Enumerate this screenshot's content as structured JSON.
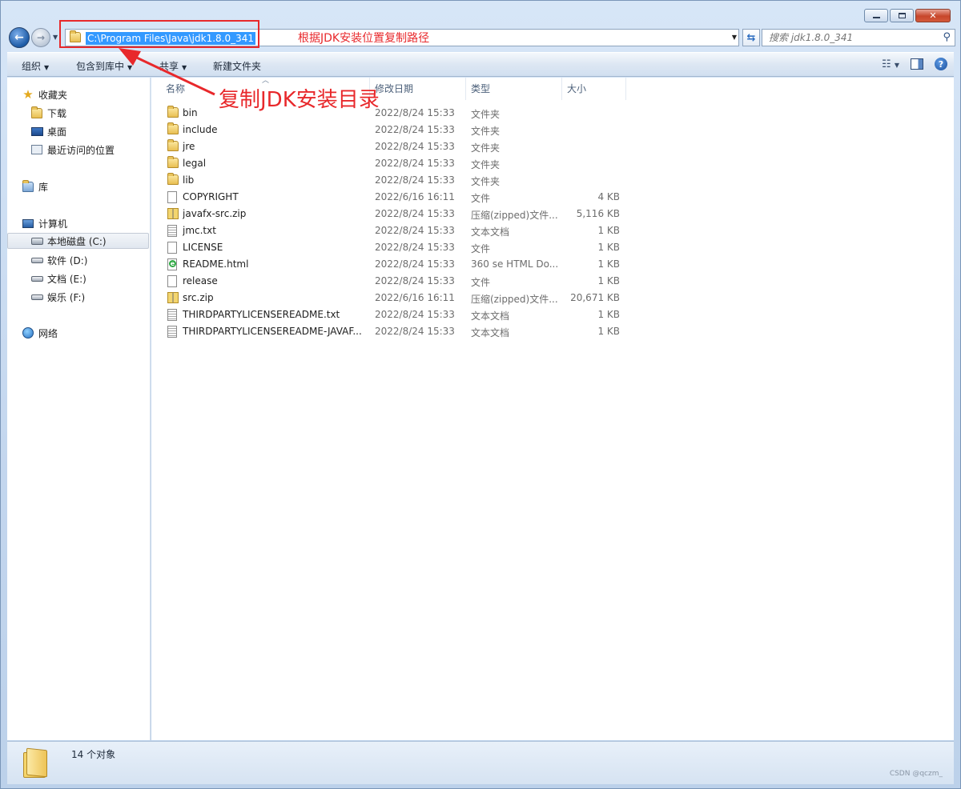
{
  "window": {
    "caption": {
      "minimize": "–",
      "maximize": "□",
      "close": "✕"
    }
  },
  "nav": {
    "address_path": "C:\\Program Files\\Java\\jdk1.8.0_341",
    "search_placeholder": "搜索 jdk1.8.0_341"
  },
  "toolbar": {
    "organize": "组织",
    "include_in_library": "包含到库中",
    "share": "共享",
    "new_folder": "新建文件夹"
  },
  "sidebar": {
    "favorites": "收藏夹",
    "downloads": "下载",
    "desktop": "桌面",
    "recent": "最近访问的位置",
    "libraries": "库",
    "computer": "计算机",
    "drive_c": "本地磁盘 (C:)",
    "drive_d": "软件 (D:)",
    "drive_e": "文档 (E:)",
    "drive_f": "娱乐 (F:)",
    "network": "网络"
  },
  "columns": {
    "name": "名称",
    "modified": "修改日期",
    "type": "类型",
    "size": "大小"
  },
  "files": [
    {
      "name": "bin",
      "modified": "2022/8/24 15:33",
      "type": "文件夹",
      "size": "",
      "icon": "folder-icon"
    },
    {
      "name": "include",
      "modified": "2022/8/24 15:33",
      "type": "文件夹",
      "size": "",
      "icon": "folder-icon"
    },
    {
      "name": "jre",
      "modified": "2022/8/24 15:33",
      "type": "文件夹",
      "size": "",
      "icon": "folder-icon"
    },
    {
      "name": "legal",
      "modified": "2022/8/24 15:33",
      "type": "文件夹",
      "size": "",
      "icon": "folder-icon"
    },
    {
      "name": "lib",
      "modified": "2022/8/24 15:33",
      "type": "文件夹",
      "size": "",
      "icon": "folder-icon"
    },
    {
      "name": "COPYRIGHT",
      "modified": "2022/6/16 16:11",
      "type": "文件",
      "size": "4 KB",
      "icon": "file-icon"
    },
    {
      "name": "javafx-src.zip",
      "modified": "2022/8/24 15:33",
      "type": "压缩(zipped)文件...",
      "size": "5,116 KB",
      "icon": "zip-icon"
    },
    {
      "name": "jmc.txt",
      "modified": "2022/8/24 15:33",
      "type": "文本文档",
      "size": "1 KB",
      "icon": "text-file-icon"
    },
    {
      "name": "LICENSE",
      "modified": "2022/8/24 15:33",
      "type": "文件",
      "size": "1 KB",
      "icon": "file-icon"
    },
    {
      "name": "README.html",
      "modified": "2022/8/24 15:33",
      "type": "360 se HTML Do...",
      "size": "1 KB",
      "icon": "html-file-icon"
    },
    {
      "name": "release",
      "modified": "2022/8/24 15:33",
      "type": "文件",
      "size": "1 KB",
      "icon": "file-icon"
    },
    {
      "name": "src.zip",
      "modified": "2022/6/16 16:11",
      "type": "压缩(zipped)文件...",
      "size": "20,671 KB",
      "icon": "zip-icon"
    },
    {
      "name": "THIRDPARTYLICENSEREADME.txt",
      "modified": "2022/8/24 15:33",
      "type": "文本文档",
      "size": "1 KB",
      "icon": "text-file-icon"
    },
    {
      "name": "THIRDPARTYLICENSEREADME-JAVAF...",
      "modified": "2022/8/24 15:33",
      "type": "文本文档",
      "size": "1 KB",
      "icon": "text-file-icon"
    }
  ],
  "status": {
    "count": "14 个对象"
  },
  "annotations": {
    "hint": "根据JDK安装位置复制路径",
    "big": "复制JDK安装目录",
    "color": "#e8282b"
  },
  "watermark": "CSDN @qczm_"
}
